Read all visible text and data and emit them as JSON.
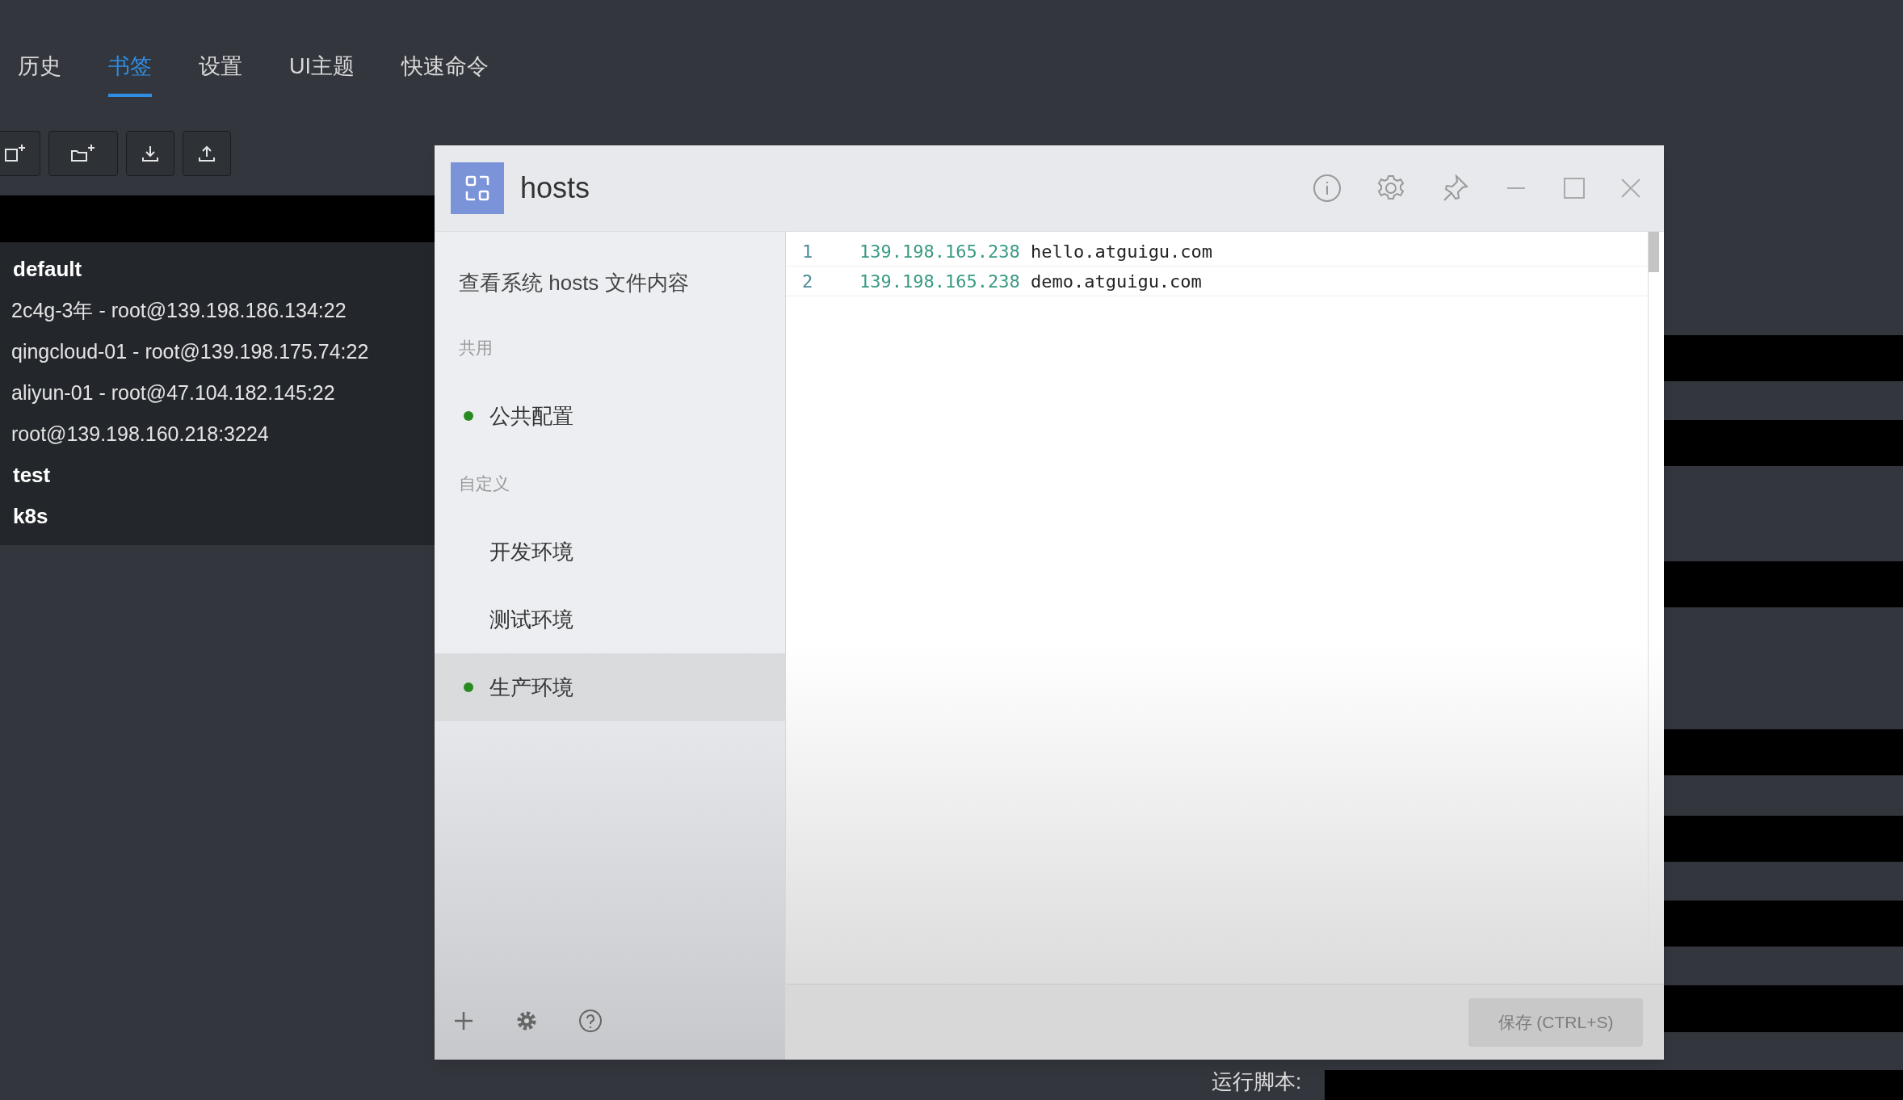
{
  "tabs": [
    {
      "label": "历史",
      "selected": false
    },
    {
      "label": "书签",
      "selected": true
    },
    {
      "label": "设置",
      "selected": false
    },
    {
      "label": "UI主题",
      "selected": false
    },
    {
      "label": "快速命令",
      "selected": false
    }
  ],
  "bookmarks": [
    {
      "label": "default",
      "kind": "group"
    },
    {
      "label": "2c4g-3年 - root@139.198.186.134:22",
      "kind": "host"
    },
    {
      "label": "qingcloud-01 - root@139.198.175.74:22",
      "kind": "host"
    },
    {
      "label": "aliyun-01 - root@47.104.182.145:22",
      "kind": "host"
    },
    {
      "label": "root@139.198.160.218:3224",
      "kind": "host"
    },
    {
      "label": "test",
      "kind": "group"
    },
    {
      "label": "k8s",
      "kind": "group"
    }
  ],
  "script_label": "运行脚本:",
  "hosts_window": {
    "title": "hosts",
    "system_item": "查看系统 hosts 文件内容",
    "sections": [
      {
        "title": "共用",
        "items": [
          {
            "label": "公共配置",
            "active": true,
            "selected": false
          }
        ]
      },
      {
        "title": "自定义",
        "items": [
          {
            "label": "开发环境",
            "active": false,
            "selected": false
          },
          {
            "label": "测试环境",
            "active": false,
            "selected": false
          },
          {
            "label": "生产环境",
            "active": true,
            "selected": true
          }
        ]
      }
    ],
    "lines": [
      {
        "number": "1",
        "ip": "139.198.165.238",
        "host": "hello.atguigu.com"
      },
      {
        "number": "2",
        "ip": "139.198.165.238",
        "host": "demo.atguigu.com"
      }
    ],
    "save_button": {
      "label": "保存 (CTRL+S)",
      "disabled": true
    }
  }
}
